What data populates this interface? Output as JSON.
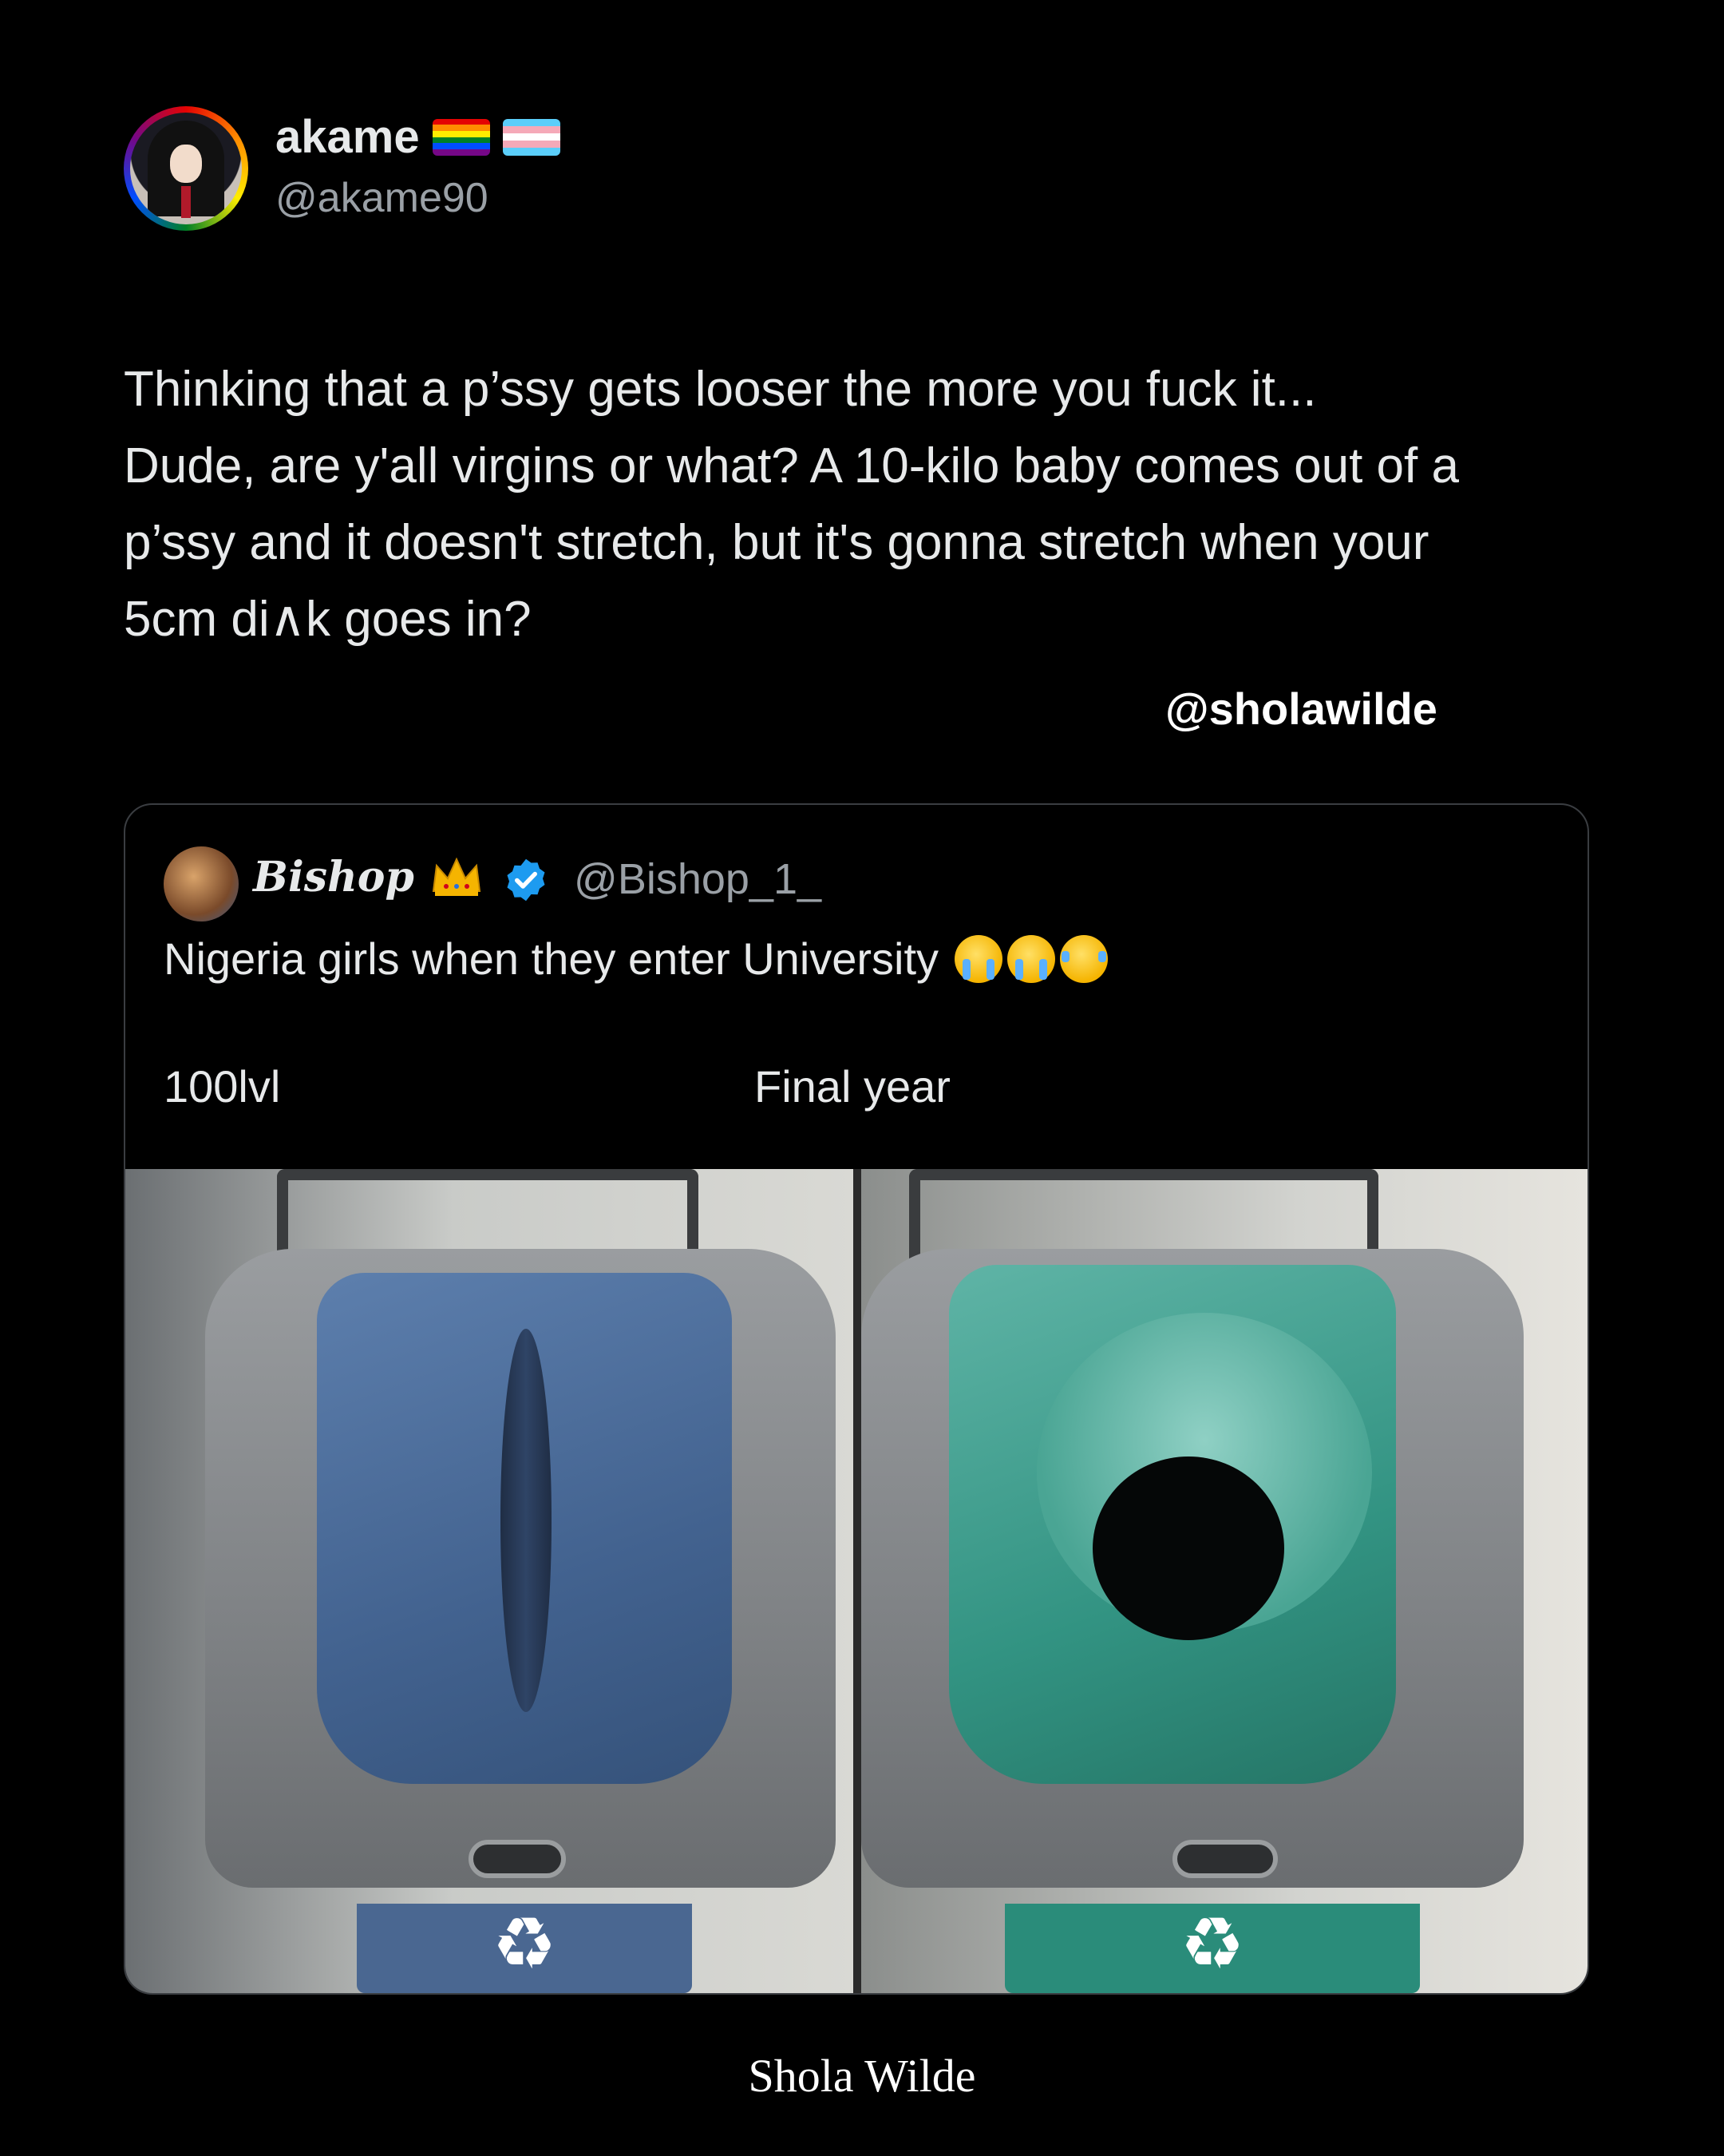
{
  "tweet": {
    "display_name": "akame",
    "handle": "@akame90",
    "flags": [
      "pride-flag-icon",
      "trans-flag-icon"
    ],
    "text": "Thinking that a p’ssy gets looser the more you fuck it...\nDude, are y'all virgins or what? A 10-kilo baby comes out of a\np’ssy and it doesn't stretch, but it's gonna stretch when your\n5cm di∧k goes in?"
  },
  "watermark": "@sholawilde",
  "quote": {
    "display_name": "Bishop",
    "handle": "@Bishop_1_",
    "text": "Nigeria girls when they enter University",
    "emojis": [
      "crying-face-emoji",
      "crying-face-emoji",
      "laughing-face-emoji"
    ],
    "left_label": "100lvl",
    "right_label": "Final year",
    "recycle_symbol": "♻"
  },
  "footer": "Shola Wilde",
  "colors": {
    "background": "#000000",
    "text": "#e7e9ea",
    "muted": "#9aa0a6",
    "verified": "#1d9bf0",
    "bin_blue": "#42628f",
    "bin_teal": "#329382"
  }
}
